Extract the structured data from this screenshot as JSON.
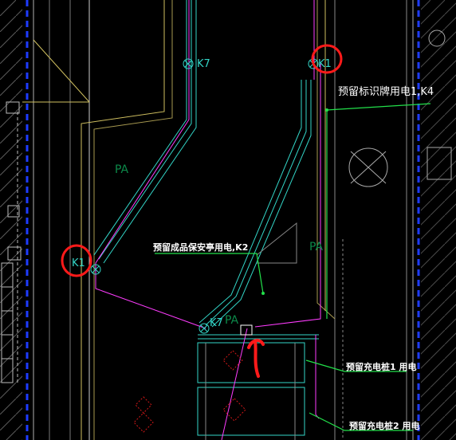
{
  "drawing": {
    "device_labels": {
      "k7_top": "K7",
      "k1_top": "K1",
      "k1_left": "K1",
      "k7_bottom": "K7"
    },
    "zone_labels": {
      "pa_left": "PA",
      "pa_right": "PA",
      "pa_bottom": "PA"
    },
    "annotations": {
      "sign_power": "预留标识牌用电1,K4",
      "security_power": "预留成品保安亭用电,K2",
      "charger1_power": "预留充电桩1 用电",
      "charger2_power": "预留充电桩2 用电"
    },
    "colors": {
      "background": "#000000",
      "cyan_walls": "#33d6c8",
      "magenta_cable": "#ff3cff",
      "green_leader": "#22e04a",
      "blue_wall": "#1e3cff",
      "markup_red": "#ff1a1a",
      "zone_green": "#0c8a4a"
    }
  }
}
